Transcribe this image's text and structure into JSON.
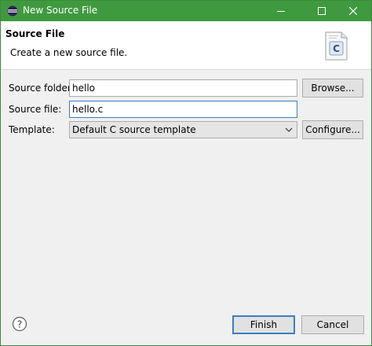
{
  "titlebar": {
    "title": "New Source File",
    "icons": {
      "app": "eclipse-icon",
      "minimize": "minimize-icon",
      "maximize": "maximize-icon",
      "close": "close-icon"
    }
  },
  "header": {
    "heading": "Source File",
    "description": "Create a new source file.",
    "icon": "c-source-file-icon"
  },
  "form": {
    "source_folder": {
      "label": "Source folder:",
      "value": "hello"
    },
    "source_file": {
      "label": "Source file:",
      "value": "hello.c"
    },
    "template": {
      "label": "Template:",
      "selected": "Default C source template"
    }
  },
  "buttons": {
    "browse": "Browse...",
    "configure": "Configure...",
    "finish": "Finish",
    "cancel": "Cancel"
  },
  "footer": {
    "help_icon": "help-icon"
  },
  "colors": {
    "titlebar": "#3f9a3f",
    "focus": "#3a7fc0"
  }
}
